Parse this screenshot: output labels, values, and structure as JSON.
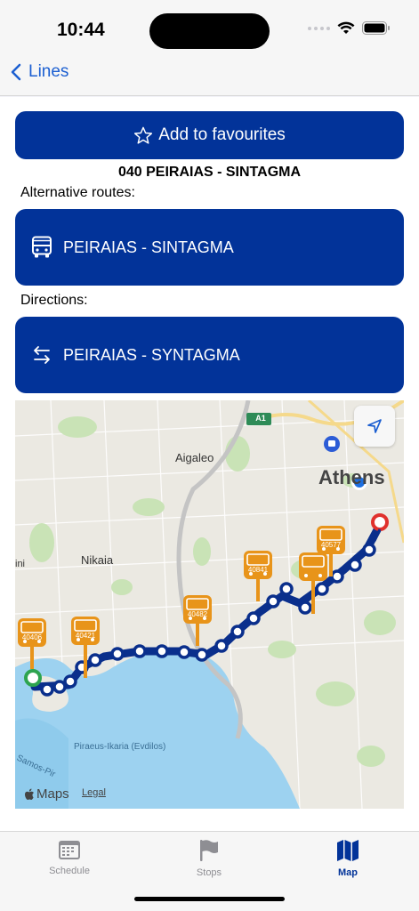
{
  "status": {
    "time": "10:44"
  },
  "nav": {
    "back_label": "Lines"
  },
  "favourite_label": "Add to favourites",
  "line_title": "040 PEIRAIAS - SINTAGMA",
  "alternative_routes_label": "Alternative routes:",
  "alternative_route": "PEIRAIAS - SINTAGMA",
  "directions_label": "Directions:",
  "direction": "PEIRAIAS - SYNTAGMA",
  "map": {
    "road_badge": "A1",
    "places": [
      "Aigaleo",
      "Athens",
      "Nikaia",
      "ini",
      "Piraeus-Ikaria (Evdilos)",
      "Samos-Pir"
    ],
    "bus_ids": [
      "40577",
      "40841",
      "40482",
      "40421",
      "40421",
      "40406"
    ],
    "attribution": "Maps",
    "legal": "Legal"
  },
  "tabs": [
    {
      "label": "Schedule",
      "icon": "calendar-icon",
      "active": false
    },
    {
      "label": "Stops",
      "icon": "flag-icon",
      "active": false
    },
    {
      "label": "Map",
      "icon": "map-icon",
      "active": true
    }
  ],
  "colors": {
    "accent": "#023399",
    "link": "#1c5fd1",
    "route": "#0a2f8c",
    "bus": "#e8941a",
    "start": "#2ea44f",
    "end": "#e0312d"
  }
}
